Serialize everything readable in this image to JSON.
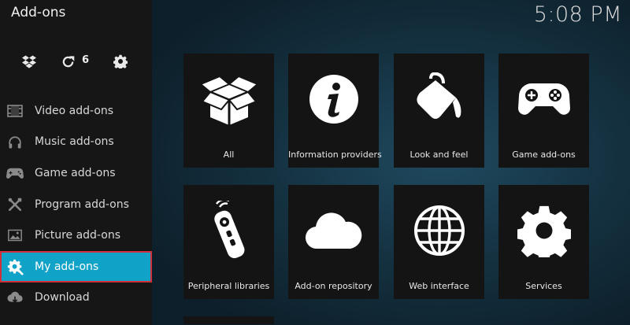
{
  "header": {
    "title": "Add-ons",
    "clock": "5:08 PM"
  },
  "toolbar": {
    "install_icon": "dropbox-icon",
    "update_icon": "refresh-icon",
    "update_count": "6",
    "settings_icon": "gear-icon"
  },
  "sidebar": {
    "items": [
      {
        "label": "Video add-ons",
        "icon": "film-icon"
      },
      {
        "label": "Music add-ons",
        "icon": "headphones-icon"
      },
      {
        "label": "Game add-ons",
        "icon": "gamepad-icon"
      },
      {
        "label": "Program add-ons",
        "icon": "tools-icon"
      },
      {
        "label": "Picture add-ons",
        "icon": "picture-icon"
      },
      {
        "label": "My add-ons",
        "icon": "cog-wrench-icon",
        "active": true
      },
      {
        "label": "Download",
        "icon": "cloud-download-icon"
      }
    ]
  },
  "tiles": [
    {
      "label": "All",
      "icon": "open-box-icon"
    },
    {
      "label": "Information providers",
      "icon": "info-icon"
    },
    {
      "label": "Look and feel",
      "icon": "paint-bucket-icon"
    },
    {
      "label": "Game add-ons",
      "icon": "gamepad-icon"
    },
    {
      "label": "Peripheral libraries",
      "icon": "remote-control-icon"
    },
    {
      "label": "Add-on repository",
      "icon": "cloud-icon"
    },
    {
      "label": "Web interface",
      "icon": "globe-icon"
    },
    {
      "label": "Services",
      "icon": "gear-icon"
    }
  ],
  "colors": {
    "accent": "#11a2c8",
    "highlight_border": "#d0303a",
    "sidebar_bg": "#161616",
    "tile_bg": "#141414"
  }
}
